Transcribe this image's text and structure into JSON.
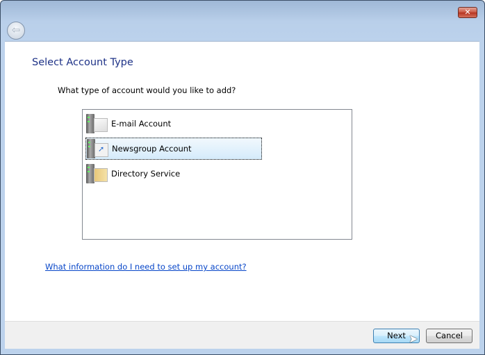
{
  "window": {
    "close_icon": "close-x-icon",
    "back_icon": "back-arrow-icon"
  },
  "page": {
    "title": "Select Account Type",
    "question": "What type of account would you like to add?"
  },
  "account_types": [
    {
      "label": "E-mail Account",
      "icon": "email-server-icon",
      "selected": false
    },
    {
      "label": "Newsgroup Account",
      "icon": "newsgroup-server-icon",
      "selected": true
    },
    {
      "label": "Directory Service",
      "icon": "directory-server-icon",
      "selected": false
    }
  ],
  "help_link": "What information do I need to set up my account?",
  "buttons": {
    "next": "Next",
    "cancel": "Cancel"
  }
}
